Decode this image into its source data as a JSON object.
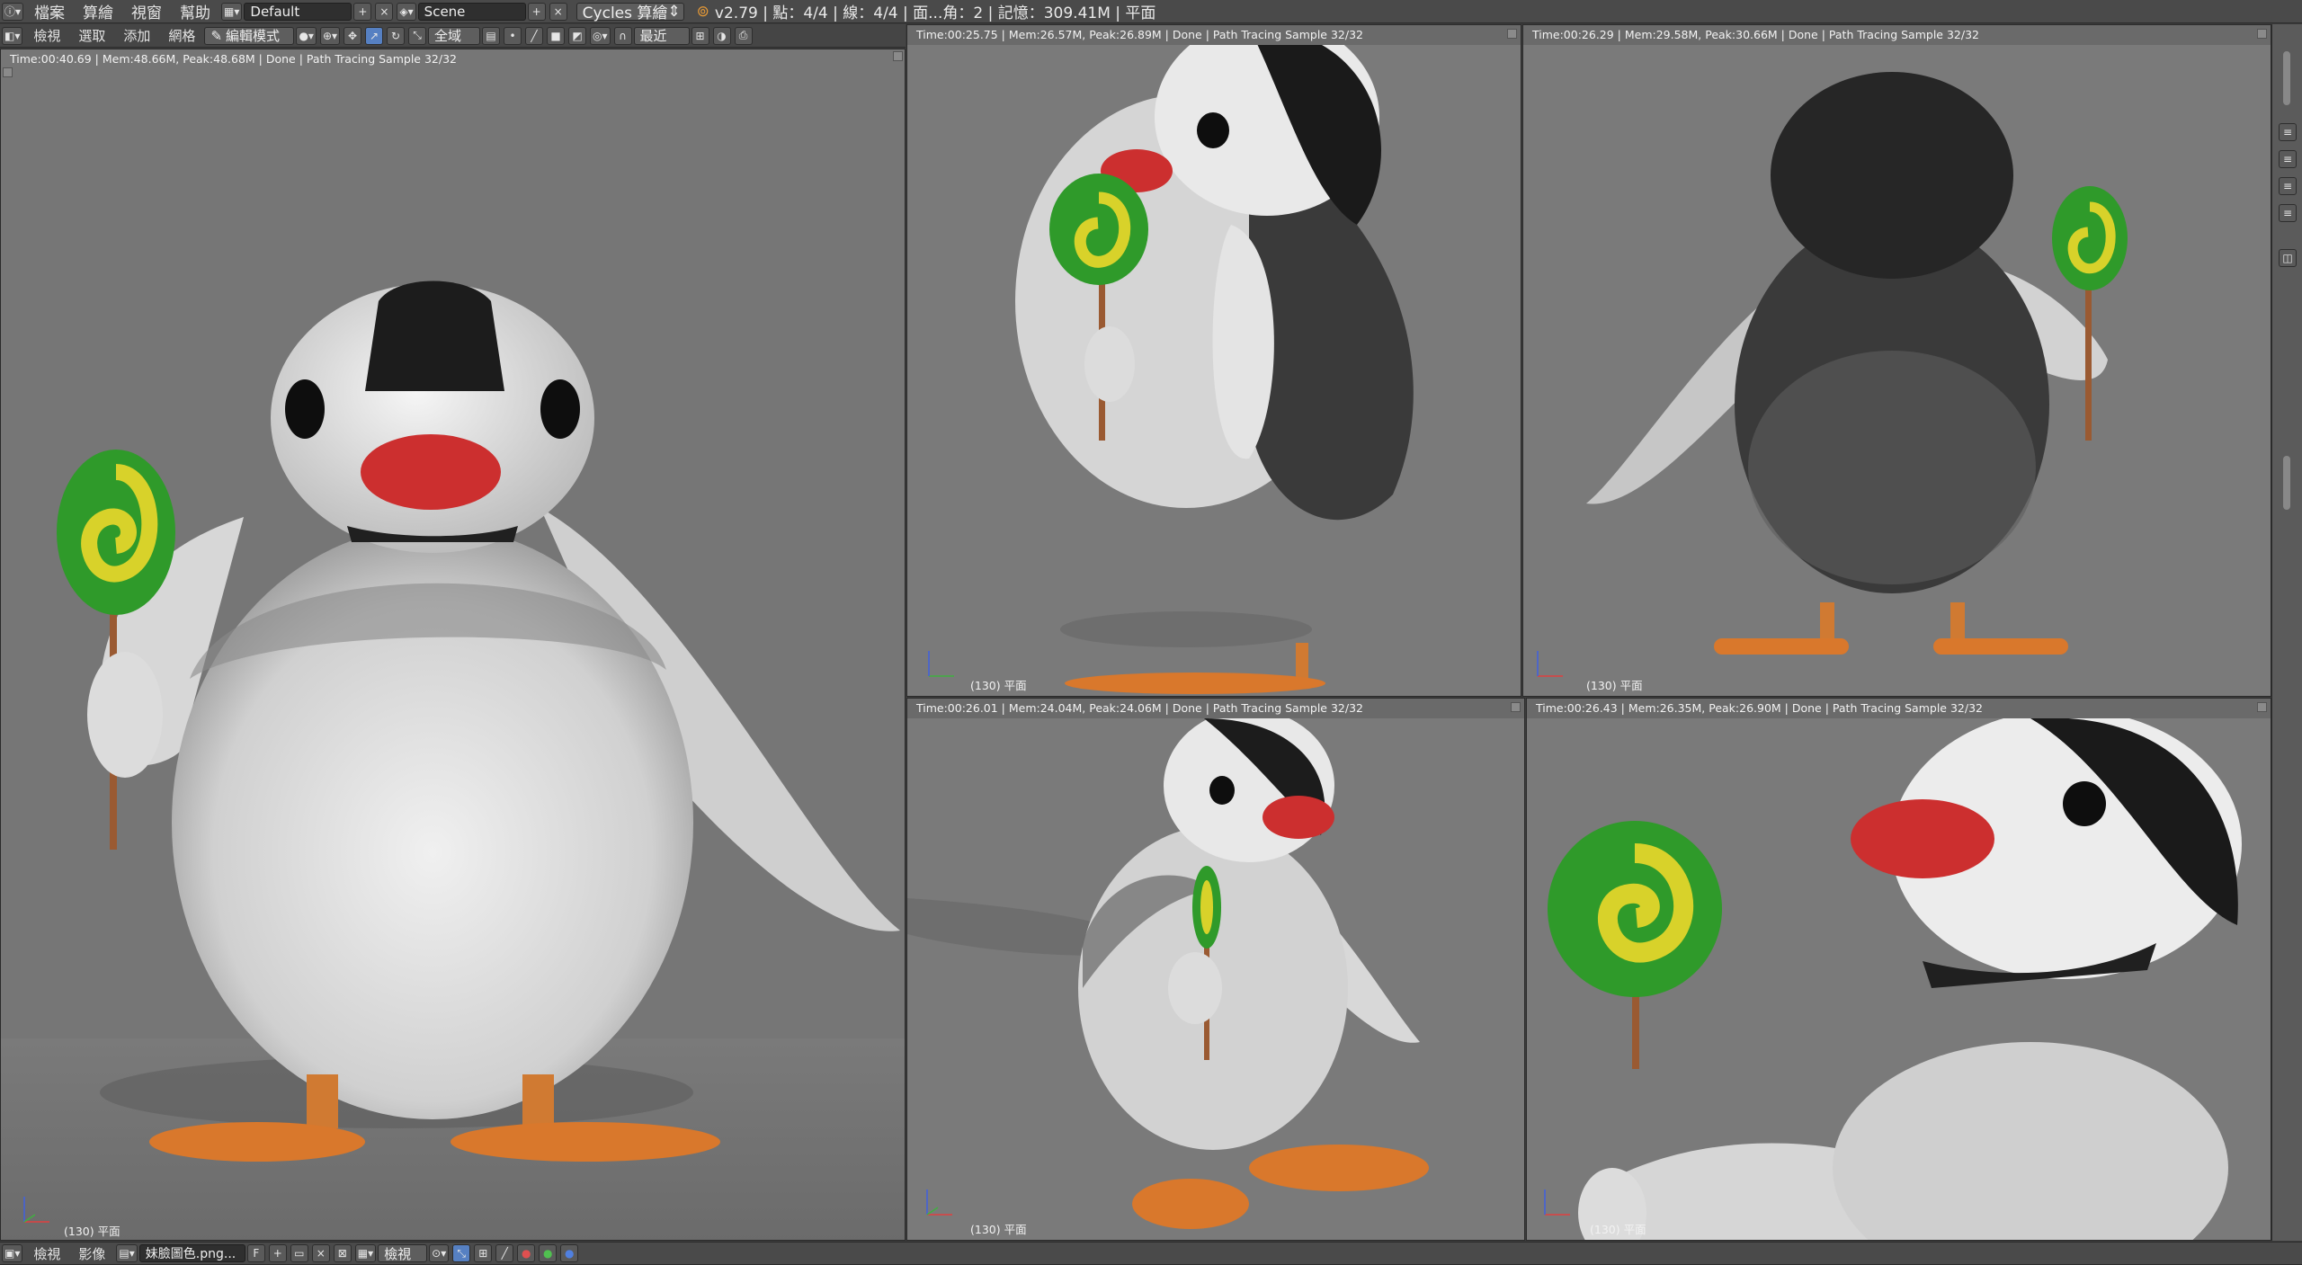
{
  "topbar": {
    "menus": [
      "檔案",
      "算繪",
      "視窗",
      "幫助"
    ],
    "layout": "Default",
    "scene": "Scene",
    "engine": "Cycles 算繪",
    "stats": "v2.79 | 點：4/4 | 線：4/4 | 面...角：2 | 記憶：309.41M | 平面"
  },
  "header3d": {
    "menus": [
      "檢視",
      "選取",
      "添加",
      "網格"
    ],
    "mode": "編輯模式",
    "pivot": "全域",
    "snap": "最近"
  },
  "viewports": [
    {
      "render_info": "Time:00:40.69 | Mem:48.66M, Peak:48.68M | Done | Path Tracing Sample 32/32",
      "frame": "(130) 平面",
      "view": "front"
    },
    {
      "render_info": "Time:00:25.75 | Mem:26.57M, Peak:26.89M | Done | Path Tracing Sample 32/32",
      "frame": "(130) 平面",
      "view": "side"
    },
    {
      "render_info": "Time:00:26.29 | Mem:29.58M, Peak:30.66M | Done | Path Tracing Sample 32/32",
      "frame": "(130) 平面",
      "view": "back"
    },
    {
      "render_info": "Time:00:26.01 | Mem:24.04M, Peak:24.06M | Done | Path Tracing Sample 32/32",
      "frame": "(130) 平面",
      "view": "three-quarter"
    },
    {
      "render_info": "Time:00:26.43 | Mem:26.35M, Peak:26.90M | Done | Path Tracing Sample 32/32",
      "frame": "(130) 平面",
      "view": "closeup"
    }
  ],
  "footer": {
    "menus": [
      "檢視",
      "影像"
    ],
    "image_name": "妹臉圖色.png...",
    "fake_user": "F",
    "view_mode": "檢視"
  },
  "colors": {
    "header_bg": "#4a4a4a",
    "viewport_bg": "#777777",
    "penguin_black": "#1c1c1c",
    "penguin_white": "#e6e6e6",
    "beak_red": "#cc2f2f",
    "feet_orange": "#d9782c",
    "lollipop_green": "#2f9a2a",
    "lollipop_yellow": "#d8d22a",
    "stick_brown": "#9a5a32"
  }
}
